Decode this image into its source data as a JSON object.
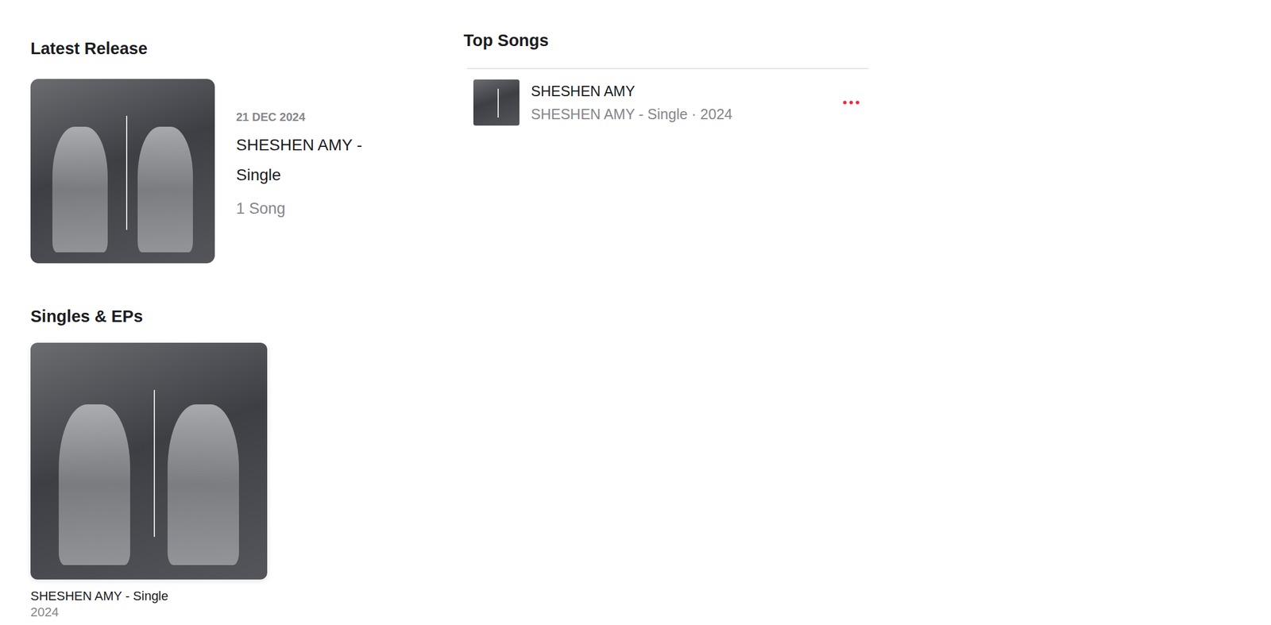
{
  "latest_release": {
    "heading": "Latest Release",
    "date": "21 DEC 2024",
    "title": "SHESHEN AMY - Single",
    "count": "1 Song"
  },
  "top_songs": {
    "heading": "Top Songs",
    "songs": [
      {
        "title": "SHESHEN AMY",
        "subtitle": "SHESHEN AMY - Single · 2024"
      }
    ]
  },
  "singles_eps": {
    "heading": "Singles & EPs",
    "items": [
      {
        "title": "SHESHEN AMY - Single",
        "year": "2024"
      }
    ]
  }
}
